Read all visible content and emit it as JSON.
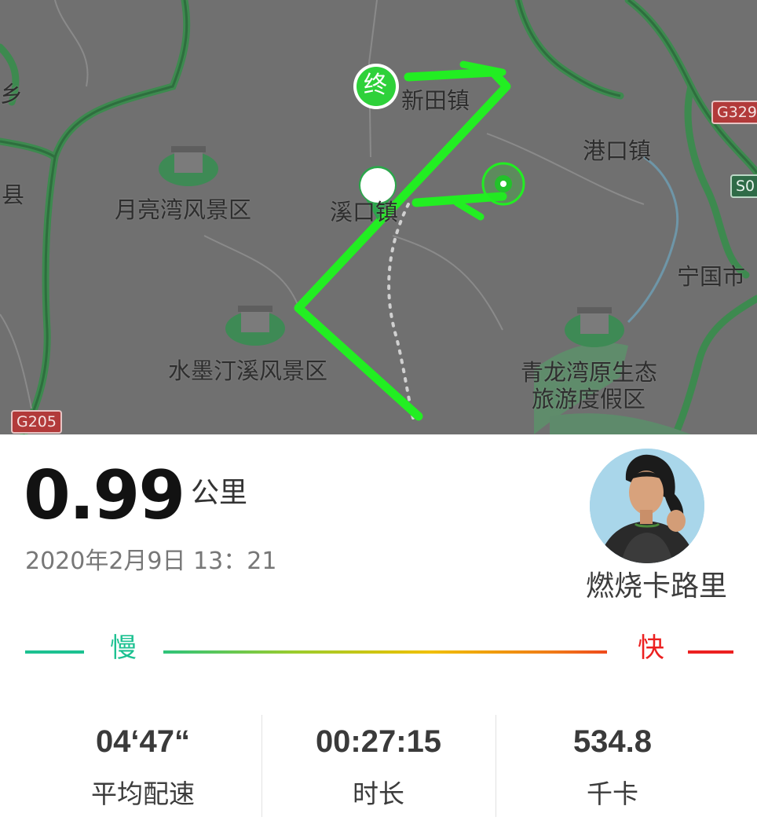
{
  "map": {
    "labels": {
      "xintian": "新田镇",
      "gangkou": "港口镇",
      "yueliangwan": "月亮湾风景区",
      "xikou": "溪口镇",
      "ningguo": "宁国市",
      "shuimoting": "水墨汀溪风景区",
      "qinglongwan_1": "青龙湾原生态",
      "qinglongwan_2": "旅游度假区",
      "edge_xiang": "乡",
      "edge_xian": "县"
    },
    "road_badges": {
      "g205": "G205",
      "g329": "G329",
      "s0": "S0"
    },
    "end_marker": "终",
    "colors": {
      "route": "#22ee22",
      "map_bg": "#707070",
      "road": "#3d8a4f"
    }
  },
  "run": {
    "distance": "0.99",
    "distance_unit": "公里",
    "datetime": "2020年2月9日 13：21"
  },
  "badge": {
    "label": "燃烧卡路里",
    "icon": "runner-avatar"
  },
  "pace_legend": {
    "slow": "慢",
    "fast": "快",
    "colors": {
      "slow": "#1cc191",
      "mid": "#f0c000",
      "fast": "#ec2020"
    }
  },
  "stats": [
    {
      "value": "04‘47“",
      "label": "平均配速"
    },
    {
      "value": "00:27:15",
      "label": "时长"
    },
    {
      "value": "534.8",
      "label": "千卡"
    }
  ]
}
